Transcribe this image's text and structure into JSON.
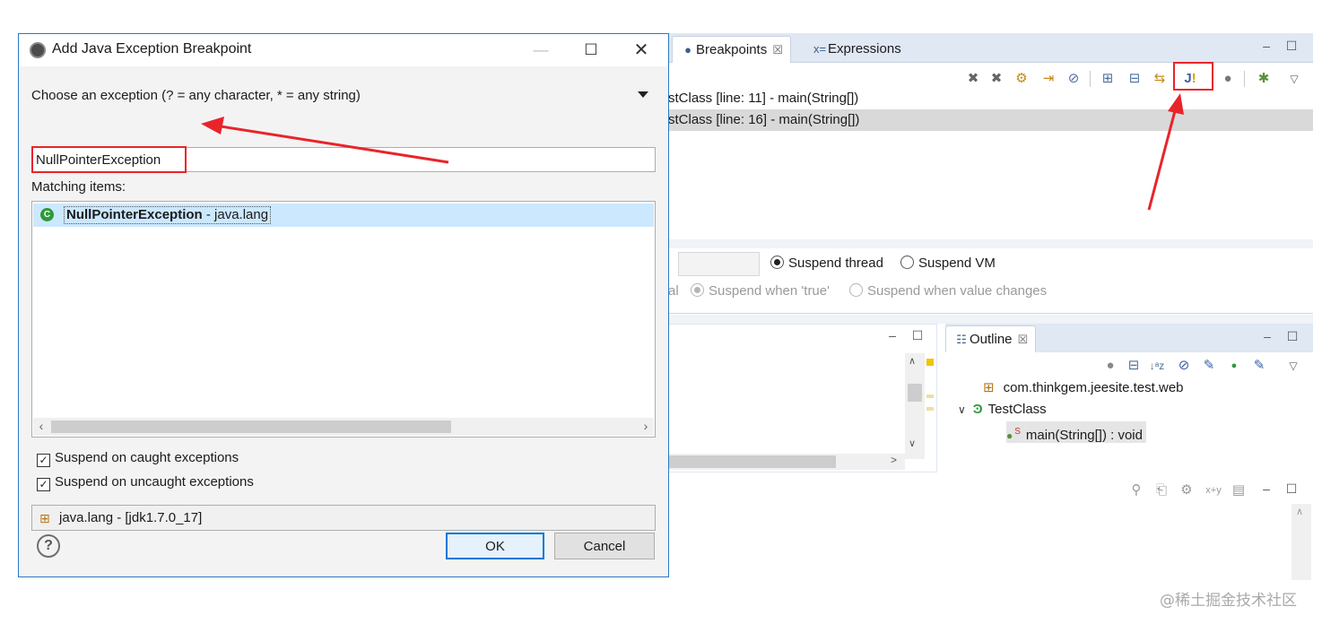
{
  "dialog": {
    "title": "Add Java Exception Breakpoint",
    "choose_label": "Choose an exception (? = any character, * = any string)",
    "search_value": "NullPointerException",
    "matching_label": "Matching items:",
    "match_item": {
      "name": "NullPointerException",
      "package": " - java.lang"
    },
    "checkboxes": {
      "caught": "Suspend on caught exceptions",
      "uncaught": "Suspend on uncaught exceptions"
    },
    "package_status": "java.lang - [jdk1.7.0_17]",
    "ok_label": "OK",
    "cancel_label": "Cancel",
    "help_glyph": "?"
  },
  "breakpoints_view": {
    "tabs": {
      "breakpoints": "Breakpoints",
      "expressions": "Expressions"
    },
    "rows": [
      "stClass [line: 11] - main(String[])",
      "stClass [line: 16] - main(String[])"
    ],
    "options": {
      "suspend_thread": "Suspend thread",
      "suspend_vm": "Suspend VM",
      "partial_label": "al",
      "suspend_when_true": "Suspend when 'true'",
      "suspend_when_changes": "Suspend when value changes"
    }
  },
  "outline_view": {
    "tab": "Outline",
    "tree": {
      "package": "com.thinkgem.jeesite.test.web",
      "class": "TestClass",
      "method": "main(String[]) : void"
    }
  },
  "watermark": "@稀土掘金技术社区",
  "colors": {
    "highlight_red": "#e8242b",
    "selection_blue": "#cce8ff",
    "tab_bar": "#dfe8f3",
    "class_icon_green": "#2e9a3a"
  }
}
